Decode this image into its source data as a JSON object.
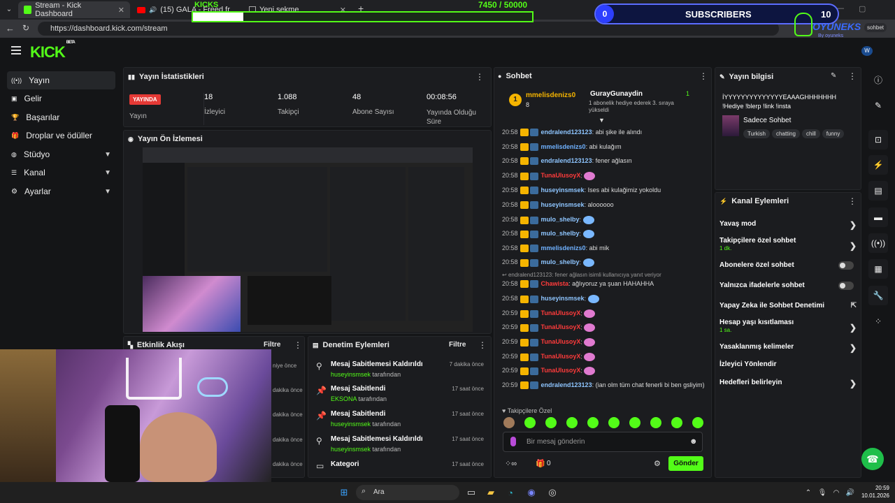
{
  "browser": {
    "tabs": [
      {
        "label": "Stream - Kick Dashboard"
      },
      {
        "label": "(15) GALA - Freed from desire"
      },
      {
        "label": "Yeni sekme"
      }
    ],
    "url": "https://dashboard.kick.com/stream"
  },
  "overlay": {
    "goal_label": "KICKS",
    "goal_progress": "7450 / 50000",
    "goal_fraction": 0.149,
    "subs_left": "0",
    "subs_title": "SUBSCRIBERS",
    "subs_right": "10",
    "brand": "OYUNEKS",
    "brand_sub": "By oyuneks",
    "sohbet_btn": "sohbet"
  },
  "app": {
    "logo": "KICK",
    "logo_sup": "BETA"
  },
  "sidebar": {
    "items": [
      {
        "label": "Yayın",
        "icon": "broadcast-icon"
      },
      {
        "label": "Gelir",
        "icon": "money-icon"
      },
      {
        "label": "Başarılar",
        "icon": "trophy-icon"
      },
      {
        "label": "Droplar ve ödüller",
        "icon": "gift-icon"
      },
      {
        "label": "Stüdyo",
        "icon": "studio-icon"
      },
      {
        "label": "Kanal",
        "icon": "channel-icon"
      },
      {
        "label": "Ayarlar",
        "icon": "gear-icon"
      }
    ]
  },
  "stats": {
    "title": "Yayın İstatistikleri",
    "live": "YAYINDA",
    "live_label": "Yayın",
    "items": [
      {
        "value": "18",
        "label": "İzleyici"
      },
      {
        "value": "1.088",
        "label": "Takipçi"
      },
      {
        "value": "48",
        "label": "Abone Sayısı"
      },
      {
        "value": "00:08:56",
        "label": "Yayında Olduğu Süre"
      }
    ]
  },
  "preview": {
    "title": "Yayın Ön İzlemesi"
  },
  "activity": {
    "title": "Etkinlik Akışı",
    "filter": "Filtre",
    "ago": [
      "niye önce",
      "dakika önce",
      "dakika önce",
      "dakika önce",
      "dakika önce"
    ]
  },
  "moderation": {
    "title": "Denetim Eylemleri",
    "filter": "Filtre",
    "items": [
      {
        "title": "Mesaj Sabitlemesi Kaldırıldı",
        "user": "huseyinsmsek",
        "suffix": "tarafından",
        "ago": "7 dakika önce"
      },
      {
        "title": "Mesaj Sabitlendi",
        "user": "EKSONA",
        "suffix": "tarafından",
        "ago": "17 saat önce"
      },
      {
        "title": "Mesaj Sabitlendi",
        "user": "huseyinsmsek",
        "suffix": "tarafından",
        "ago": "17 saat önce"
      },
      {
        "title": "Mesaj Sabitlemesi Kaldırıldı",
        "user": "huseyinsmsek",
        "suffix": "tarafından",
        "ago": "17 saat önce"
      },
      {
        "title": "Kategori",
        "user": "",
        "suffix": "",
        "ago": "17 saat önce"
      }
    ]
  },
  "chat": {
    "title": "Sohbet",
    "pinned_user": "mmelisdenizs0",
    "pinned_count": "8",
    "gift_user": "GurayGunaydin",
    "gift_text": "1 abonelik hediye ederek 3. sıraya yükseldi",
    "gift_count": "1",
    "messages": [
      {
        "time": "20:58",
        "user": "endralend123123",
        "color": "#8ec5ff",
        "text": "abi şike ile alındı"
      },
      {
        "time": "20:58",
        "user": "mmelisdenizs0",
        "color": "#6fb1ff",
        "text": "abi kulağım"
      },
      {
        "time": "20:58",
        "user": "endralend123123",
        "color": "#8ec5ff",
        "text": "fener ağlasın"
      },
      {
        "time": "20:58",
        "user": "TunaUlusoyX",
        "color": "#ff3b3b",
        "text": ""
      },
      {
        "time": "20:58",
        "user": "huseyinsmsek",
        "color": "#8ec5ff",
        "text": "Ises abi kulağimiz yokoldu"
      },
      {
        "time": "20:58",
        "user": "huseyinsmsek",
        "color": "#8ec5ff",
        "text": "aloooooo"
      },
      {
        "time": "20:58",
        "user": "mulo_shelby",
        "color": "#8ec5ff",
        "text": ""
      },
      {
        "time": "20:58",
        "user": "mulo_shelby",
        "color": "#8ec5ff",
        "text": ""
      },
      {
        "time": "20:58",
        "user": "mmelisdenizs0",
        "color": "#6fb1ff",
        "text": "abi mik"
      },
      {
        "time": "20:58",
        "user": "mulo_shelby",
        "color": "#8ec5ff",
        "text": ""
      }
    ],
    "reply_hint": "endralend123123: fener ağlasın isimli kullanıcıya yanıt veriyor",
    "messages2": [
      {
        "time": "20:58",
        "user": "Chawista",
        "color": "#ff3b3b",
        "text": "ağlıyoruz ya şuan HAHAHHA"
      },
      {
        "time": "20:58",
        "user": "huseyinsmsek",
        "color": "#8ec5ff",
        "text": ""
      },
      {
        "time": "20:59",
        "user": "TunaUlusoyX",
        "color": "#ff3b3b",
        "text": ""
      },
      {
        "time": "20:59",
        "user": "TunaUlusoyX",
        "color": "#ff3b3b",
        "text": ""
      },
      {
        "time": "20:59",
        "user": "TunaUlusoyX",
        "color": "#ff3b3b",
        "text": ""
      },
      {
        "time": "20:59",
        "user": "TunaUlusoyX",
        "color": "#ff3b3b",
        "text": ""
      },
      {
        "time": "20:59",
        "user": "TunaUlusoyX",
        "color": "#ff3b3b",
        "text": ""
      }
    ],
    "last_msg": {
      "time": "20:59",
      "user": "endralend123123",
      "text": "(ian olm tüm chat fenerli bi ben gsliyim)"
    },
    "followers_only": "Takipçilere Özel",
    "input_placeholder": "Bir mesaj gönderin",
    "points": "0",
    "send": "Gönder"
  },
  "stream_info": {
    "title": "Yayın bilgisi",
    "text": "İYYYYYYYYYYYYYYEAAAGHHHHHHH !Hediye !blerp !link !insta",
    "category": "Sadece Sohbet",
    "tags": [
      "Turkish",
      "chatting",
      "chill",
      "funny"
    ]
  },
  "channel_actions": {
    "title": "Kanal Eylemleri",
    "items": [
      {
        "label": "Yavaş mod",
        "sub": "",
        "control": "arrow"
      },
      {
        "label": "Takipçilere özel sohbet",
        "sub": "1 dk.",
        "control": "arrow"
      },
      {
        "label": "Abonelere özel sohbet",
        "sub": "",
        "control": "toggle"
      },
      {
        "label": "Yalnızca ifadelerle sohbet",
        "sub": "",
        "control": "toggle"
      },
      {
        "label": "Yapay Zeka ile Sohbet Denetimi",
        "sub": "",
        "control": "external"
      },
      {
        "label": "Hesap yaşı kısıtlaması",
        "sub": "1 sa.",
        "control": "arrow"
      },
      {
        "label": "Yasaklanmış kelimeler",
        "sub": "",
        "control": "arrow"
      },
      {
        "label": "İzleyici Yönlendir",
        "sub": "",
        "control": "none"
      },
      {
        "label": "Hedefleri belirleyin",
        "sub": "",
        "control": "arrow"
      }
    ]
  },
  "taskbar": {
    "search": "Ara",
    "time": "20:59",
    "date": "10.01.2026"
  },
  "colors": {
    "accent": "#53fc18",
    "live": "#e53935",
    "bg": "#141517",
    "panel": "#1b1c1f"
  }
}
